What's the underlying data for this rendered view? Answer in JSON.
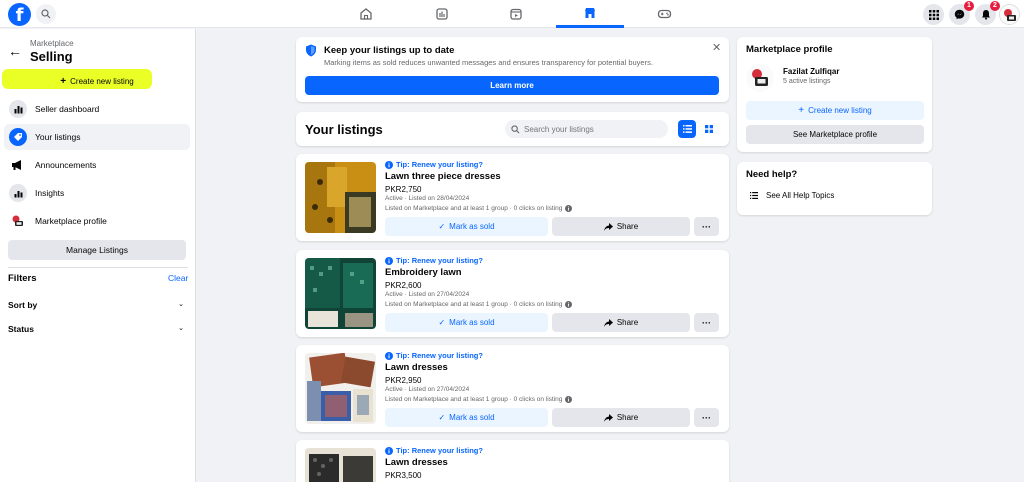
{
  "topbar": {
    "logo_letter": "f",
    "messenger_badge": "1",
    "notifications_badge": "2",
    "active_tab": "marketplace"
  },
  "sidebar": {
    "supertitle": "Marketplace",
    "title": "Selling",
    "create_label": "Create new listing",
    "items": [
      {
        "label": "Seller dashboard",
        "icon": "dashboard-icon"
      },
      {
        "label": "Your listings",
        "icon": "tag-icon"
      },
      {
        "label": "Announcements",
        "icon": "megaphone-icon"
      },
      {
        "label": "Insights",
        "icon": "insights-icon"
      },
      {
        "label": "Marketplace profile",
        "icon": "avatar"
      }
    ],
    "manage_label": "Manage Listings",
    "filters_label": "Filters",
    "clear_label": "Clear",
    "sort_label": "Sort by",
    "status_label": "Status"
  },
  "banner": {
    "title": "Keep your listings up to date",
    "subtitle": "Marking items as sold reduces unwanted messages and ensures transparency for potential buyers.",
    "learn_more": "Learn more"
  },
  "listings_header": {
    "title": "Your listings",
    "search_placeholder": "Search your listings"
  },
  "listings": [
    {
      "tip": "Tip: Renew your listing?",
      "title": "Lawn three piece dresses",
      "price": "PKR2,750",
      "status": "Active · Listed on 28/04/2024",
      "reach": "Listed on Marketplace and at least 1 group · 0 clicks on listing",
      "mark_sold": "Mark as sold",
      "share": "Share",
      "more": "···"
    },
    {
      "tip": "Tip: Renew your listing?",
      "title": "Embroidery lawn",
      "price": "PKR2,600",
      "status": "Active · Listed on 27/04/2024",
      "reach": "Listed on Marketplace and at least 1 group · 0 clicks on listing",
      "mark_sold": "Mark as sold",
      "share": "Share",
      "more": "···"
    },
    {
      "tip": "Tip: Renew your listing?",
      "title": "Lawn dresses",
      "price": "PKR2,950",
      "status": "Active · Listed on 27/04/2024",
      "reach": "Listed on Marketplace and at least 1 group · 0 clicks on listing",
      "mark_sold": "Mark as sold",
      "share": "Share",
      "more": "···"
    },
    {
      "tip": "Tip: Renew your listing?",
      "title": "Lawn dresses",
      "price": "PKR3,500"
    }
  ],
  "profile_panel": {
    "title": "Marketplace profile",
    "name": "Fazilat Zulfiqar",
    "active_listings": "5 active listings",
    "create_label": "Create new listing",
    "see_profile": "See Marketplace profile"
  },
  "help_panel": {
    "title": "Need help?",
    "item": "See All Help Topics"
  },
  "colors": {
    "accent": "#0866ff",
    "highlight": "#e6ff00",
    "badge": "#e41e3f"
  }
}
